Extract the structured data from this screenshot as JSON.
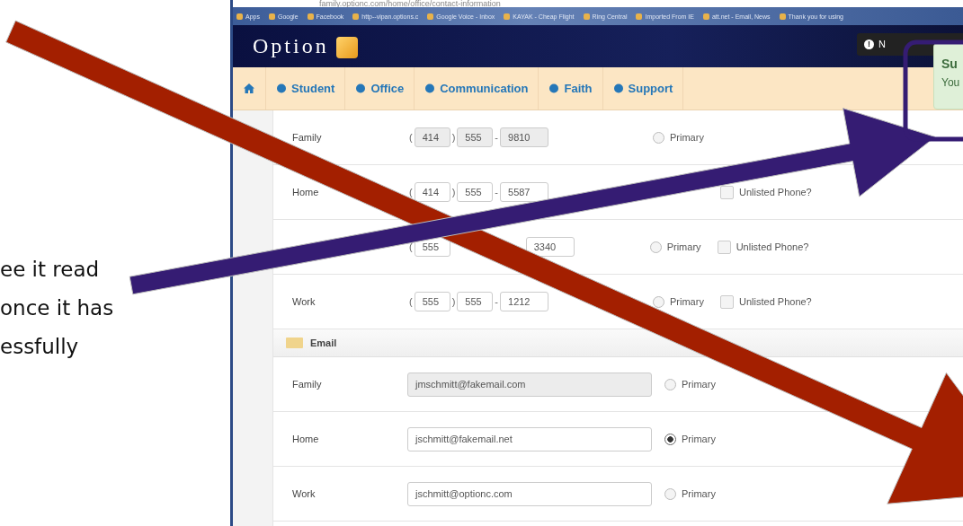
{
  "slide_text": [
    "ee it read",
    "once it has",
    "essfully"
  ],
  "browser": {
    "url": "family.optionc.com/home/office/contact-information",
    "bookmarks": [
      "Apps",
      "Google",
      "Facebook",
      "http--vipan.options.c",
      "Google Voice - Inbox",
      "KAYAK - Cheap Flight",
      "Ring Central",
      "Imported From IE",
      "att.net - Email, News",
      "Thank you for using"
    ]
  },
  "header": {
    "logo": "Option",
    "notification_icon": "!",
    "notification_label": "N"
  },
  "nav": [
    "Student",
    "Office",
    "Communication",
    "Faith",
    "Support"
  ],
  "phones": [
    {
      "label": "Family",
      "open": "(",
      "area": "414",
      "close": ")",
      "prefix": "555",
      "dash": "-",
      "line": "9810",
      "disabled": true,
      "primary": {
        "label": "Primary",
        "selected": false
      }
    },
    {
      "label": "Home",
      "open": "(",
      "area": "414",
      "close": ")",
      "prefix": "555",
      "dash": "-",
      "line": "5587",
      "disabled": false,
      "unlisted": {
        "label": "Unlisted Phone?",
        "checked": false
      }
    },
    {
      "open": "(",
      "area": "555",
      "line": "3340",
      "disabled": false,
      "primary": {
        "label": "Primary",
        "selected": false
      },
      "unlisted": {
        "label": "Unlisted Phone?",
        "checked": false
      }
    },
    {
      "label": "Work",
      "open": "(",
      "area": "555",
      "close": ")",
      "prefix": "555",
      "dash": "-",
      "line": "1212",
      "disabled": false,
      "primary": {
        "label": "Primary",
        "selected": false
      },
      "unlisted": {
        "label": "Unlisted Phone?",
        "checked": false
      }
    }
  ],
  "email_section": {
    "title": "Email",
    "rows": [
      {
        "label": "Family",
        "value": "jmschmitt@fakemail.com",
        "disabled": true,
        "primary": {
          "label": "Primary",
          "selected": false
        }
      },
      {
        "label": "Home",
        "value": "jschmitt@fakemail.net",
        "disabled": false,
        "primary": {
          "label": "Primary",
          "selected": true
        }
      },
      {
        "label": "Work",
        "value": "jschmitt@optionc.com",
        "disabled": false,
        "primary": {
          "label": "Primary",
          "selected": false
        }
      }
    ]
  },
  "toast": {
    "title": "Su",
    "message": "You"
  },
  "annotations": [
    {
      "kind": "arrow",
      "color": "#a31f00"
    },
    {
      "kind": "arrow",
      "color": "#351c73"
    },
    {
      "kind": "frame",
      "color": "#351c73"
    }
  ]
}
